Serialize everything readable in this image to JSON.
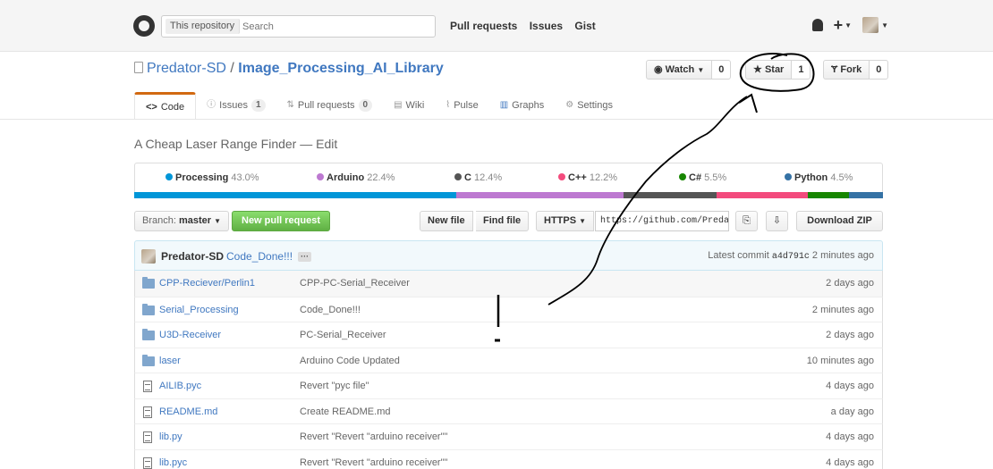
{
  "header": {
    "search_scope": "This repository",
    "search_placeholder": "Search",
    "nav": [
      "Pull requests",
      "Issues",
      "Gist"
    ]
  },
  "repo": {
    "owner": "Predator-SD",
    "separator": "/",
    "name": "Image_Processing_AI_Library",
    "watch_label": "Watch",
    "watch_count": "0",
    "star_label": "Star",
    "star_count": "1",
    "fork_label": "Fork",
    "fork_count": "0"
  },
  "tabs": [
    {
      "label": "Code",
      "icon": "code-icon",
      "active": true
    },
    {
      "label": "Issues",
      "count": "1",
      "icon": "issue-icon"
    },
    {
      "label": "Pull requests",
      "count": "0",
      "icon": "pull-request-icon"
    },
    {
      "label": "Wiki",
      "icon": "book-icon"
    },
    {
      "label": "Pulse",
      "icon": "pulse-icon"
    },
    {
      "label": "Graphs",
      "icon": "graph-icon"
    },
    {
      "label": "Settings",
      "icon": "gear-icon"
    }
  ],
  "description": "A Cheap Laser Range Finder — Edit",
  "languages": [
    {
      "name": "Processing",
      "percent": "43.0%",
      "color": "#0096d8",
      "fraction": 0.43
    },
    {
      "name": "Arduino",
      "percent": "22.4%",
      "color": "#bd79d1",
      "fraction": 0.224
    },
    {
      "name": "C",
      "percent": "12.4%",
      "color": "#555555",
      "fraction": 0.124
    },
    {
      "name": "C++",
      "percent": "12.2%",
      "color": "#f34b7d",
      "fraction": 0.122
    },
    {
      "name": "C#",
      "percent": "5.5%",
      "color": "#178600",
      "fraction": 0.055
    },
    {
      "name": "Python",
      "percent": "4.5%",
      "color": "#3572a5",
      "fraction": 0.045
    }
  ],
  "toolbar": {
    "branch_prefix": "Branch:",
    "branch": "master",
    "new_pr": "New pull request",
    "new_file": "New file",
    "find_file": "Find file",
    "protocol": "HTTPS",
    "clone_url": "https://github.com/Predator-SD/Image_Processing_AI_Library.git",
    "download_zip": "Download ZIP"
  },
  "commit": {
    "author": "Predator-SD",
    "message": "Code_Done!!!",
    "latest_prefix": "Latest commit",
    "sha": "a4d791c",
    "age": "2 minutes ago"
  },
  "files": [
    {
      "name": "CPP-Reciever/Perlin1",
      "type": "dir",
      "message": "CPP-PC-Serial_Receiver",
      "age": "2 days ago"
    },
    {
      "name": "Serial_Processing",
      "type": "dir",
      "message": "Code_Done!!!",
      "age": "2 minutes ago"
    },
    {
      "name": "U3D-Receiver",
      "type": "dir",
      "message": "PC-Serial_Receiver",
      "age": "2 days ago"
    },
    {
      "name": "laser",
      "type": "dir",
      "message": "Arduino Code Updated",
      "age": "10 minutes ago"
    },
    {
      "name": "AILIB.pyc",
      "type": "file",
      "message": "Revert \"pyc file\"",
      "age": "4 days ago"
    },
    {
      "name": "README.md",
      "type": "file",
      "message": "Create README.md",
      "age": "a day ago"
    },
    {
      "name": "lib.py",
      "type": "file",
      "message": "Revert \"Revert \"arduino receiver\"\"",
      "age": "4 days ago"
    },
    {
      "name": "lib.pyc",
      "type": "file",
      "message": "Revert \"Revert \"arduino receiver\"\"",
      "age": "4 days ago"
    }
  ],
  "colors": {
    "link": "#4078c0",
    "tab_accent": "#d26911",
    "new_pr_green": "#60b044",
    "commit_bg": "#f2f9fc"
  }
}
